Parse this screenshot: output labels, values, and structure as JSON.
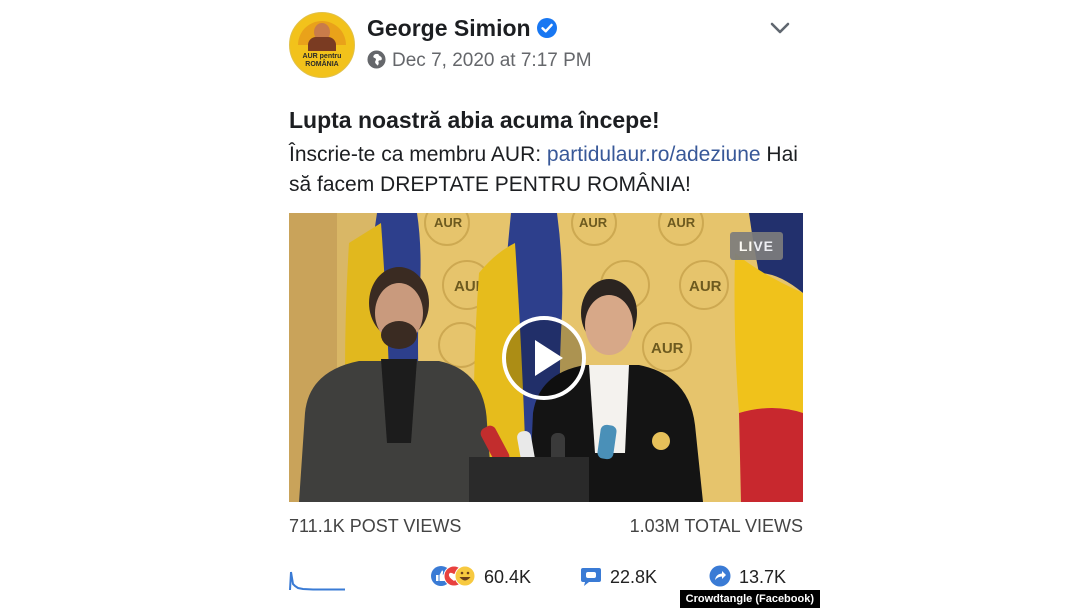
{
  "post": {
    "author": "George Simion",
    "timestamp": "Dec 7, 2020 at 7:17 PM",
    "avatar_text": "AUR pentru ROMÂNIA",
    "headline": "Lupta noastră abia acuma începe!",
    "body_prefix": "Înscrie-te ca membru AUR: ",
    "body_link": "partidulaur.ro/adeziune",
    "body_suffix": " Hai să facem DREPTATE PENTRU ROMÂNIA!"
  },
  "video": {
    "badge": "LIVE",
    "backdrop_text": "AUR"
  },
  "stats": {
    "post_views": "711.1K POST VIEWS",
    "total_views": "1.03M TOTAL VIEWS"
  },
  "engagement": {
    "reactions": "60.4K",
    "comments": "22.8K",
    "shares": "13.7K"
  },
  "credit": "Crowdtangle (Facebook)",
  "colors": {
    "link": "#385898",
    "verified": "#1877f2",
    "accent_blue": "#3a7bd5",
    "banner_yellow": "#e8c874"
  },
  "icons": [
    "verified-badge-icon",
    "globe-icon",
    "chevron-down-icon",
    "play-icon",
    "like-love-haha-icon",
    "comment-icon",
    "share-icon"
  ]
}
